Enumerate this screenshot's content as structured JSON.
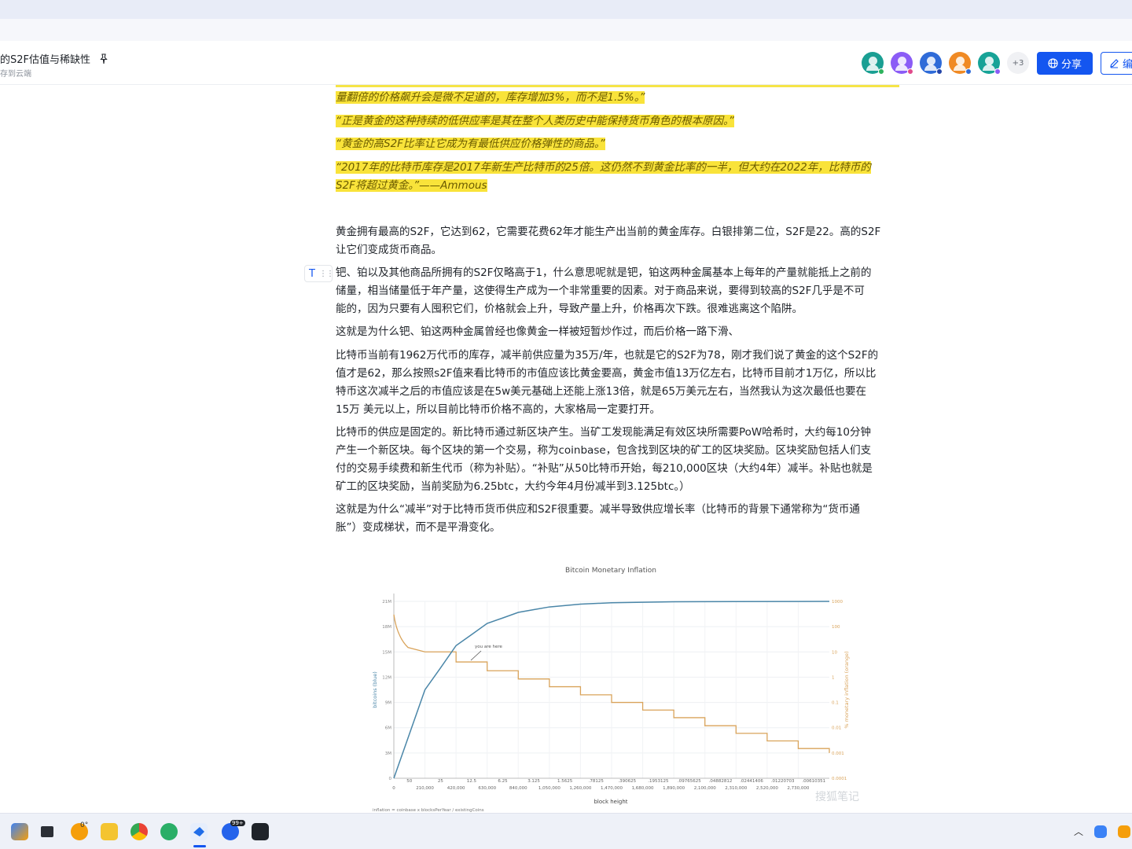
{
  "header": {
    "doc_title": "的S2F估值与稀缺性",
    "save_status": "存到云端",
    "more_collaborators": "+3",
    "share_label": "分享",
    "edit_label": "编"
  },
  "avatars": [
    {
      "color": "#1a9f93",
      "dot": "#2db35d"
    },
    {
      "color": "#8b5cf6",
      "dot": "#e04a8b"
    },
    {
      "color": "#2f6bd8",
      "dot": "#2445a8"
    },
    {
      "color": "#f08a24",
      "dot": "#2f6bd8"
    },
    {
      "color": "#17a397",
      "dot": "#8b5cf6"
    }
  ],
  "quotes": [
    "量翻倍的价格飙升会是微不足道的，库存增加3%，而不是1.5%。”",
    "“正是黄金的这种持续的低供应率是其在整个人类历史中能保持货币角色的根本原因。”",
    "“黄金的高S2F比率让它成为有最低供应价格弹性的商品。”",
    "“2017年的比特币库存是2017年新生产比特币的25倍。这仍然不到黄金比率的一半，但大约在2022年，比特币的",
    "S2F将超过黄金。”——Ammous"
  ],
  "paragraphs": [
    [
      "黄金拥有最高的S2F，它达到62，它需要花费62年才能生产出当前的黄金库存。白银排第二位，S2F是22。高的S2F",
      "让它们变成货币商品。"
    ],
    [
      "钯、铂以及其他商品所拥有的S2F仅略高于1，什么意思呢就是钯，铂这两种金属基本上每年的产量就能抵上之前的",
      "储量，相当储量低于年产量，这使得生产成为一个非常重要的因素。对于商品来说，要得到较高的S2F几乎是不可",
      "能的，因为只要有人囤积它们，价格就会上升，导致产量上升，价格再次下跌。很难逃离这个陷阱。"
    ],
    [
      "这就是为什么钯、铂这两种金属曾经也像黄金一样被短暂炒作过，而后价格一路下滑、"
    ],
    [
      "比特币当前有1962万代币的库存，减半前供应量为35万/年，也就是它的S2F为78，刚才我们说了黄金的这个S2F的",
      "值才是62，那么按照s2F值来看比特币的市值应该比黄金要高，黄金市值13万亿左右，比特币目前才1万亿，所以比",
      "特币这次减半之后的市值应该是在5w美元基础上还能上涨13倍，就是65万美元左右，当然我认为这次最低也要在",
      "15万 美元以上，所以目前比特币价格不高的，大家格局一定要打开。"
    ],
    [
      "比特币的供应是固定的。新比特币通过新区块产生。当矿工发现能满足有效区块所需要PoW哈希时，大约每10分钟",
      "产生一个新区块。每个区块的第一个交易，称为coinbase，包含找到区块的矿工的区块奖励。区块奖励包括人们支",
      "付的交易手续费和新生代币（称为补贴）。“补贴”从50比特币开始，每210,000区块（大约4年）减半。补贴也就是",
      "矿工的区块奖励，当前奖励为6.25btc，大约今年4月份减半到3.125btc。）"
    ],
    [
      "这就是为什么“减半”对于比特币货币供应和S2F很重要。减半导致供应增长率（比特币的背景下通常称为“货币通",
      "胀”）变成梯状，而不是平滑变化。"
    ]
  ],
  "chart_data": {
    "type": "line",
    "title": "Bitcoin Monetary Inflation",
    "xlabel": "block height",
    "ylabel_left": "bitcoins (blue)",
    "ylabel_right": "% monetary inflation (orange)",
    "x_ticks": [
      "0",
      "210,000",
      "420,000",
      "630,000",
      "840,000",
      "1,050,000",
      "1,260,000",
      "1,470,000",
      "1,680,000",
      "1,890,000",
      "2,100,000",
      "2,310,000",
      "2,520,000",
      "2,730,000"
    ],
    "reward_labels": [
      "50",
      "25",
      "12.5",
      "6.25",
      "3.125",
      "1.5625",
      ".78125",
      ".390625",
      ".1953125",
      ".09765625",
      ".04882812",
      ".02441406",
      ".01220703",
      ".00610351"
    ],
    "y_left_ticks": [
      "21M",
      "18M",
      "15M",
      "12M",
      "9M",
      "6M",
      "3M",
      "0"
    ],
    "y_right_ticks": [
      "1000",
      "100",
      "10",
      "1",
      "0.1",
      "0.01",
      "0.001",
      "0.0001"
    ],
    "annotation": "you are here",
    "footnote": "inflation = coinbase x blocksPerYear / existingCoins",
    "watermark": "搜狐笔记",
    "series": [
      {
        "name": "bitcoins (blue)",
        "color": "#4a86a8",
        "x": [
          0,
          105000,
          210000,
          315000,
          420000,
          525000,
          630000,
          735000,
          840000,
          945000,
          1050000,
          1260000,
          1470000,
          1890000,
          2310000,
          2730000,
          2940000
        ],
        "y": [
          0,
          5.25,
          10.5,
          13.1,
          15.75,
          17.06,
          18.38,
          19.03,
          19.69,
          20.02,
          20.34,
          20.67,
          20.84,
          20.95,
          20.98,
          20.99,
          21.0
        ]
      },
      {
        "name": "% monetary inflation (orange)",
        "color": "#d9a35a",
        "x": [
          0,
          210000,
          420000,
          630000,
          840000,
          1050000,
          1260000,
          1470000,
          1680000,
          1890000,
          2100000,
          2310000,
          2520000,
          2730000,
          2940000
        ],
        "y": [
          300,
          10,
          4,
          1.8,
          0.85,
          0.42,
          0.2,
          0.1,
          0.05,
          0.025,
          0.012,
          0.006,
          0.003,
          0.0015,
          0.001
        ]
      }
    ]
  },
  "taskbar": {
    "weather_temp": "0°",
    "badge": "99+"
  }
}
